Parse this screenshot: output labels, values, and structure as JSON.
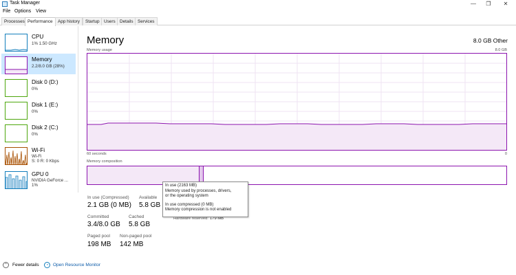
{
  "window": {
    "title": "Task Manager",
    "minimize": "—",
    "maximize": "❐",
    "close": "✕"
  },
  "menu": [
    "File",
    "Options",
    "View"
  ],
  "tabs": [
    "Processes",
    "Performance",
    "App history",
    "Startup",
    "Users",
    "Details",
    "Services"
  ],
  "active_tab": "Performance",
  "sidebar": {
    "items": [
      {
        "name": "CPU",
        "line1": "1% 1.50 GHz",
        "line2": ""
      },
      {
        "name": "Memory",
        "line1": "2.2/8.0 GB (28%)",
        "line2": ""
      },
      {
        "name": "Disk 0 (D:)",
        "line1": "0%",
        "line2": ""
      },
      {
        "name": "Disk 1 (E:)",
        "line1": "0%",
        "line2": ""
      },
      {
        "name": "Disk 2 (C:)",
        "line1": "0%",
        "line2": ""
      },
      {
        "name": "Wi-Fi",
        "line1": "Wi-Fi",
        "line2": "S: 0 R: 0 Kbps"
      },
      {
        "name": "GPU 0",
        "line1": "NVIDIA GeForce ...",
        "line2": "1%"
      }
    ]
  },
  "main": {
    "title": "Memory",
    "capacity": "8.0 GB Other",
    "usage_label": "Memory usage",
    "usage_max": "8.0 GB",
    "time_start": "60 seconds",
    "time_end": "0",
    "composition_label": "Memory composition"
  },
  "stats": {
    "in_use_label": "In use (Compressed)",
    "in_use_value": "2.1 GB (0 MB)",
    "available_label": "Available",
    "available_value": "5.8 GB",
    "hardware_reserved_label": "Hardware reserved:",
    "hardware_reserved_value": "179 MB",
    "committed_label": "Committed",
    "committed_value": "3.4/8.0 GB",
    "cached_label": "Cached",
    "cached_value": "5.8 GB",
    "paged_label": "Paged pool",
    "paged_value": "198 MB",
    "nonpaged_label": "Non-paged pool",
    "nonpaged_value": "142 MB"
  },
  "tooltip": {
    "line1": "In use (2163 MB)",
    "line2": "Memory used by processes, drivers,",
    "line3": "or the operating system",
    "line4": "In use compressed (0 MB)",
    "line5": "Memory compression is not enabled"
  },
  "footer": {
    "fewer_details": "Fewer details",
    "resource_monitor": "Open Resource Monitor"
  },
  "colors": {
    "memory_accent": "#8b12ae",
    "selection": "#cce8ff",
    "disk_accent": "#4da60c",
    "network_accent": "#a74f01",
    "cpu_accent": "#117dbb"
  }
}
